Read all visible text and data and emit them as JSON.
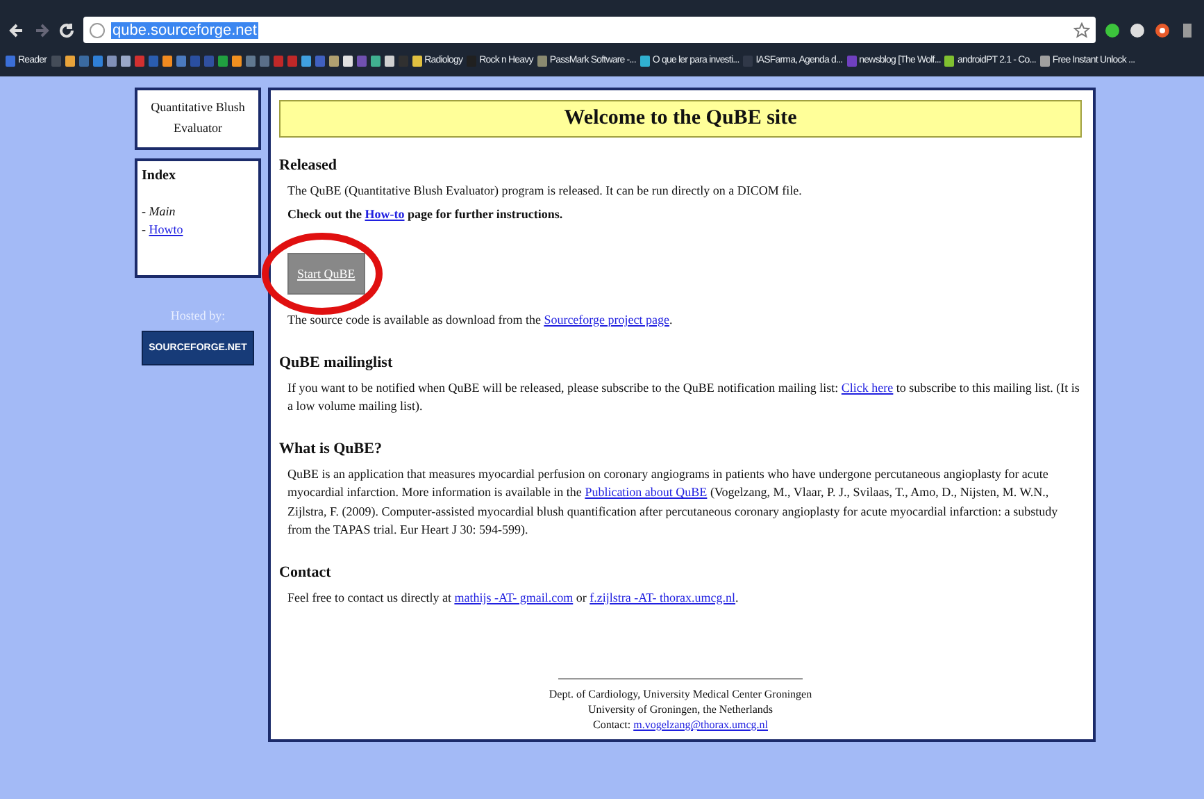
{
  "browser": {
    "url": "qube.sourceforge.net",
    "bookmarks": [
      {
        "kind": "labeled",
        "label": "Reader",
        "color": "#3b6fd8"
      },
      {
        "kind": "icon",
        "color": "#444c58"
      },
      {
        "kind": "icon",
        "color": "#e8a33a"
      },
      {
        "kind": "icon",
        "color": "#3a6aa0"
      },
      {
        "kind": "icon",
        "color": "#2f7fd6"
      },
      {
        "kind": "icon",
        "color": "#8090b8"
      },
      {
        "kind": "icon",
        "color": "#9aa8c8"
      },
      {
        "kind": "icon",
        "color": "#d23030"
      },
      {
        "kind": "icon",
        "color": "#2a5db0"
      },
      {
        "kind": "icon",
        "color": "#f08a20"
      },
      {
        "kind": "icon",
        "color": "#4a7ac0"
      },
      {
        "kind": "icon",
        "color": "#2a4fa0"
      },
      {
        "kind": "icon",
        "color": "#3050a0"
      },
      {
        "kind": "icon",
        "color": "#20a040"
      },
      {
        "kind": "icon",
        "color": "#f09020"
      },
      {
        "kind": "icon",
        "color": "#607890"
      },
      {
        "kind": "icon",
        "color": "#5a6e88"
      },
      {
        "kind": "icon",
        "color": "#c02828"
      },
      {
        "kind": "icon",
        "color": "#c02828"
      },
      {
        "kind": "icon",
        "color": "#40a0e0"
      },
      {
        "kind": "icon",
        "color": "#4060c0"
      },
      {
        "kind": "icon",
        "color": "#b0a070"
      },
      {
        "kind": "icon",
        "color": "#e0e0e0"
      },
      {
        "kind": "icon",
        "color": "#7050b0"
      },
      {
        "kind": "icon",
        "color": "#40b090"
      },
      {
        "kind": "icon",
        "color": "#d0d0d0"
      },
      {
        "kind": "icon",
        "color": "#303030"
      },
      {
        "kind": "labeled",
        "label": "Radiology",
        "color": "#e0c040"
      },
      {
        "kind": "labeled",
        "label": "Rock n Heavy",
        "color": "#202020"
      },
      {
        "kind": "labeled",
        "label": "PassMark Software -...",
        "color": "#8a8a70"
      },
      {
        "kind": "labeled",
        "label": "O que ler para investi...",
        "color": "#30b0d0"
      },
      {
        "kind": "labeled",
        "label": "IASFarma, Agenda d...",
        "color": "#303848"
      },
      {
        "kind": "labeled",
        "label": "newsblog [The Wolf...",
        "color": "#7040c0"
      },
      {
        "kind": "labeled",
        "label": "androidPT 2.1 - Co...",
        "color": "#80c030"
      },
      {
        "kind": "labeled",
        "label": "Free Instant Unlock ...",
        "color": "#a0a0a0"
      }
    ]
  },
  "sidebar": {
    "title_lines": [
      "Quantitative Blush",
      "Evaluator"
    ],
    "index": {
      "heading": "Index",
      "items": [
        {
          "marker": "-",
          "label": "Main",
          "selected": true
        },
        {
          "marker": "-",
          "label": "Howto",
          "selected": false
        }
      ]
    },
    "hosted_by": "Hosted by:",
    "badge": "SOURCEFORGE.NET"
  },
  "main": {
    "title": "Welcome to the QuBE site",
    "released": {
      "heading": "Released",
      "paragraphs": [
        {
          "bold": false,
          "parts": [
            {
              "text": "The QuBE (Quantitative Blush Evaluator) program is released. It can be run directly on a DICOM file.",
              "link": false
            }
          ]
        },
        {
          "bold": true,
          "parts": [
            {
              "text": "Check out the ",
              "link": false
            },
            {
              "text": "How-to",
              "link": true
            },
            {
              "text": " page for further instructions.",
              "link": false
            }
          ]
        }
      ],
      "button": "Start QuBE",
      "source": [
        {
          "text": "The source code is available as download from the ",
          "link": false
        },
        {
          "text": "Sourceforge project page",
          "link": true
        },
        {
          "text": ".",
          "link": false
        }
      ]
    },
    "sections": [
      {
        "heading": "QuBE mailinglist",
        "parts": [
          {
            "text": "If you want to be notified when QuBE will be released, please subscribe to the QuBE notification mailing list: ",
            "link": false
          },
          {
            "text": "Click here",
            "link": true
          },
          {
            "text": " to subscribe to this mailing list. (It is a low volume mailing list).",
            "link": false
          }
        ]
      },
      {
        "heading": "What is QuBE?",
        "parts": [
          {
            "text": "QuBE is an application that measures myocardial perfusion on coronary angiograms in patients who have undergone percutaneous angioplasty for acute myocardial infarction. More information is available in the ",
            "link": false
          },
          {
            "text": "Publication about QuBE",
            "link": true
          },
          {
            "text": " (Vogelzang, M., Vlaar, P. J., Svilaas, T., Amo, D., Nijsten, M. W.N., Zijlstra, F. (2009). Computer-assisted myocardial blush quantification after percutaneous coronary angioplasty for acute myocardial infarction: a substudy from the TAPAS trial. Eur Heart J 30: 594-599).",
            "link": false
          }
        ]
      },
      {
        "heading": "Contact",
        "parts": [
          {
            "text": "Feel free to contact us directly at ",
            "link": false
          },
          {
            "text": "mathijs -AT- gmail.com",
            "link": true
          },
          {
            "text": " or ",
            "link": false
          },
          {
            "text": "f.zijlstra -AT- thorax.umcg.nl",
            "link": true
          },
          {
            "text": ".",
            "link": false
          }
        ]
      }
    ],
    "footer": {
      "lines": [
        "Dept. of Cardiology, University Medical Center Groningen",
        "University of Groningen, the Netherlands"
      ],
      "contact_label": "Contact: ",
      "contact_link": "m.vogelzang@thorax.umcg.nl"
    }
  }
}
